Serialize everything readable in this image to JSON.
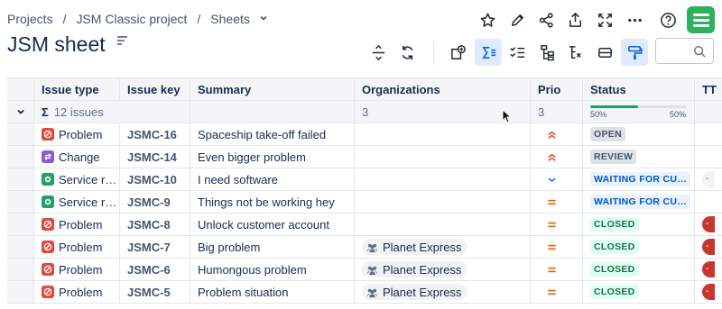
{
  "breadcrumbs": {
    "projects": "Projects",
    "project": "JSM Classic project",
    "section": "Sheets"
  },
  "page": {
    "title": "JSM sheet"
  },
  "toolbar_icons": [
    "star-icon",
    "pencil-icon",
    "share-icon",
    "export-icon",
    "fullscreen-icon",
    "more-icon",
    "help-icon"
  ],
  "sheet_toolbar_icons": [
    "row-height-icon",
    "refresh-icon",
    "add-field-icon",
    "sum-icon",
    "checklist-icon",
    "hierarchy-icon",
    "structure-icon",
    "rows-icon",
    "format-paint-icon"
  ],
  "search": {
    "placeholder": "",
    "value": ""
  },
  "columns": {
    "type": "Issue type",
    "key": "Issue key",
    "summary": "Summary",
    "organizations": "Organizations",
    "priority": "Prio",
    "status": "Status",
    "ttr": "TT"
  },
  "summary_row": {
    "sigma": "Σ",
    "issues": "12 issues",
    "org_count": "3",
    "prio_count": "3",
    "status_progress": 0.5,
    "left_pct": "50%",
    "right_pct": "50%"
  },
  "rows": [
    {
      "type": "Problem",
      "type_kind": "problem",
      "key": "JSMC-16",
      "summary": "Spaceship take-off failed",
      "org": "",
      "priority": "highest",
      "status": "OPEN",
      "status_kind": "grey",
      "ttr": ""
    },
    {
      "type": "Change",
      "type_kind": "change",
      "key": "JSMC-14",
      "summary": "Even bigger problem",
      "org": "",
      "priority": "highest",
      "status": "REVIEW",
      "status_kind": "grey",
      "ttr": ""
    },
    {
      "type": "Service r…",
      "type_kind": "service",
      "key": "JSMC-10",
      "summary": "I need software",
      "org": "",
      "priority": "low",
      "status": "WAITING FOR CU…",
      "status_kind": "blue",
      "ttr": "-"
    },
    {
      "type": "Service r…",
      "type_kind": "service",
      "key": "JSMC-9",
      "summary": "Things not be working hey",
      "org": "",
      "priority": "medium",
      "status": "WAITING FOR CU…",
      "status_kind": "blue",
      "ttr": ""
    },
    {
      "type": "Problem",
      "type_kind": "problem",
      "key": "JSMC-8",
      "summary": "Unlock customer account",
      "org": "",
      "priority": "medium",
      "status": "CLOSED",
      "status_kind": "green",
      "ttr": "-"
    },
    {
      "type": "Problem",
      "type_kind": "problem",
      "key": "JSMC-7",
      "summary": "Big problem",
      "org": "Planet Express",
      "priority": "medium",
      "status": "CLOSED",
      "status_kind": "green",
      "ttr": "-"
    },
    {
      "type": "Problem",
      "type_kind": "problem",
      "key": "JSMC-6",
      "summary": "Humongous problem",
      "org": "Planet Express",
      "priority": "medium",
      "status": "CLOSED",
      "status_kind": "green",
      "ttr": "-"
    },
    {
      "type": "Problem",
      "type_kind": "problem",
      "key": "JSMC-5",
      "summary": "Problem situation",
      "org": "Planet Express",
      "priority": "medium",
      "status": "CLOSED",
      "status_kind": "green",
      "ttr": "-"
    }
  ],
  "colors": {
    "accent": "#0c66e4",
    "brand": "#2cb15c",
    "priority_highest": "#e34935",
    "priority_medium": "#d97008",
    "priority_low": "#1d7afc",
    "ttr_red": "#c9372c"
  }
}
